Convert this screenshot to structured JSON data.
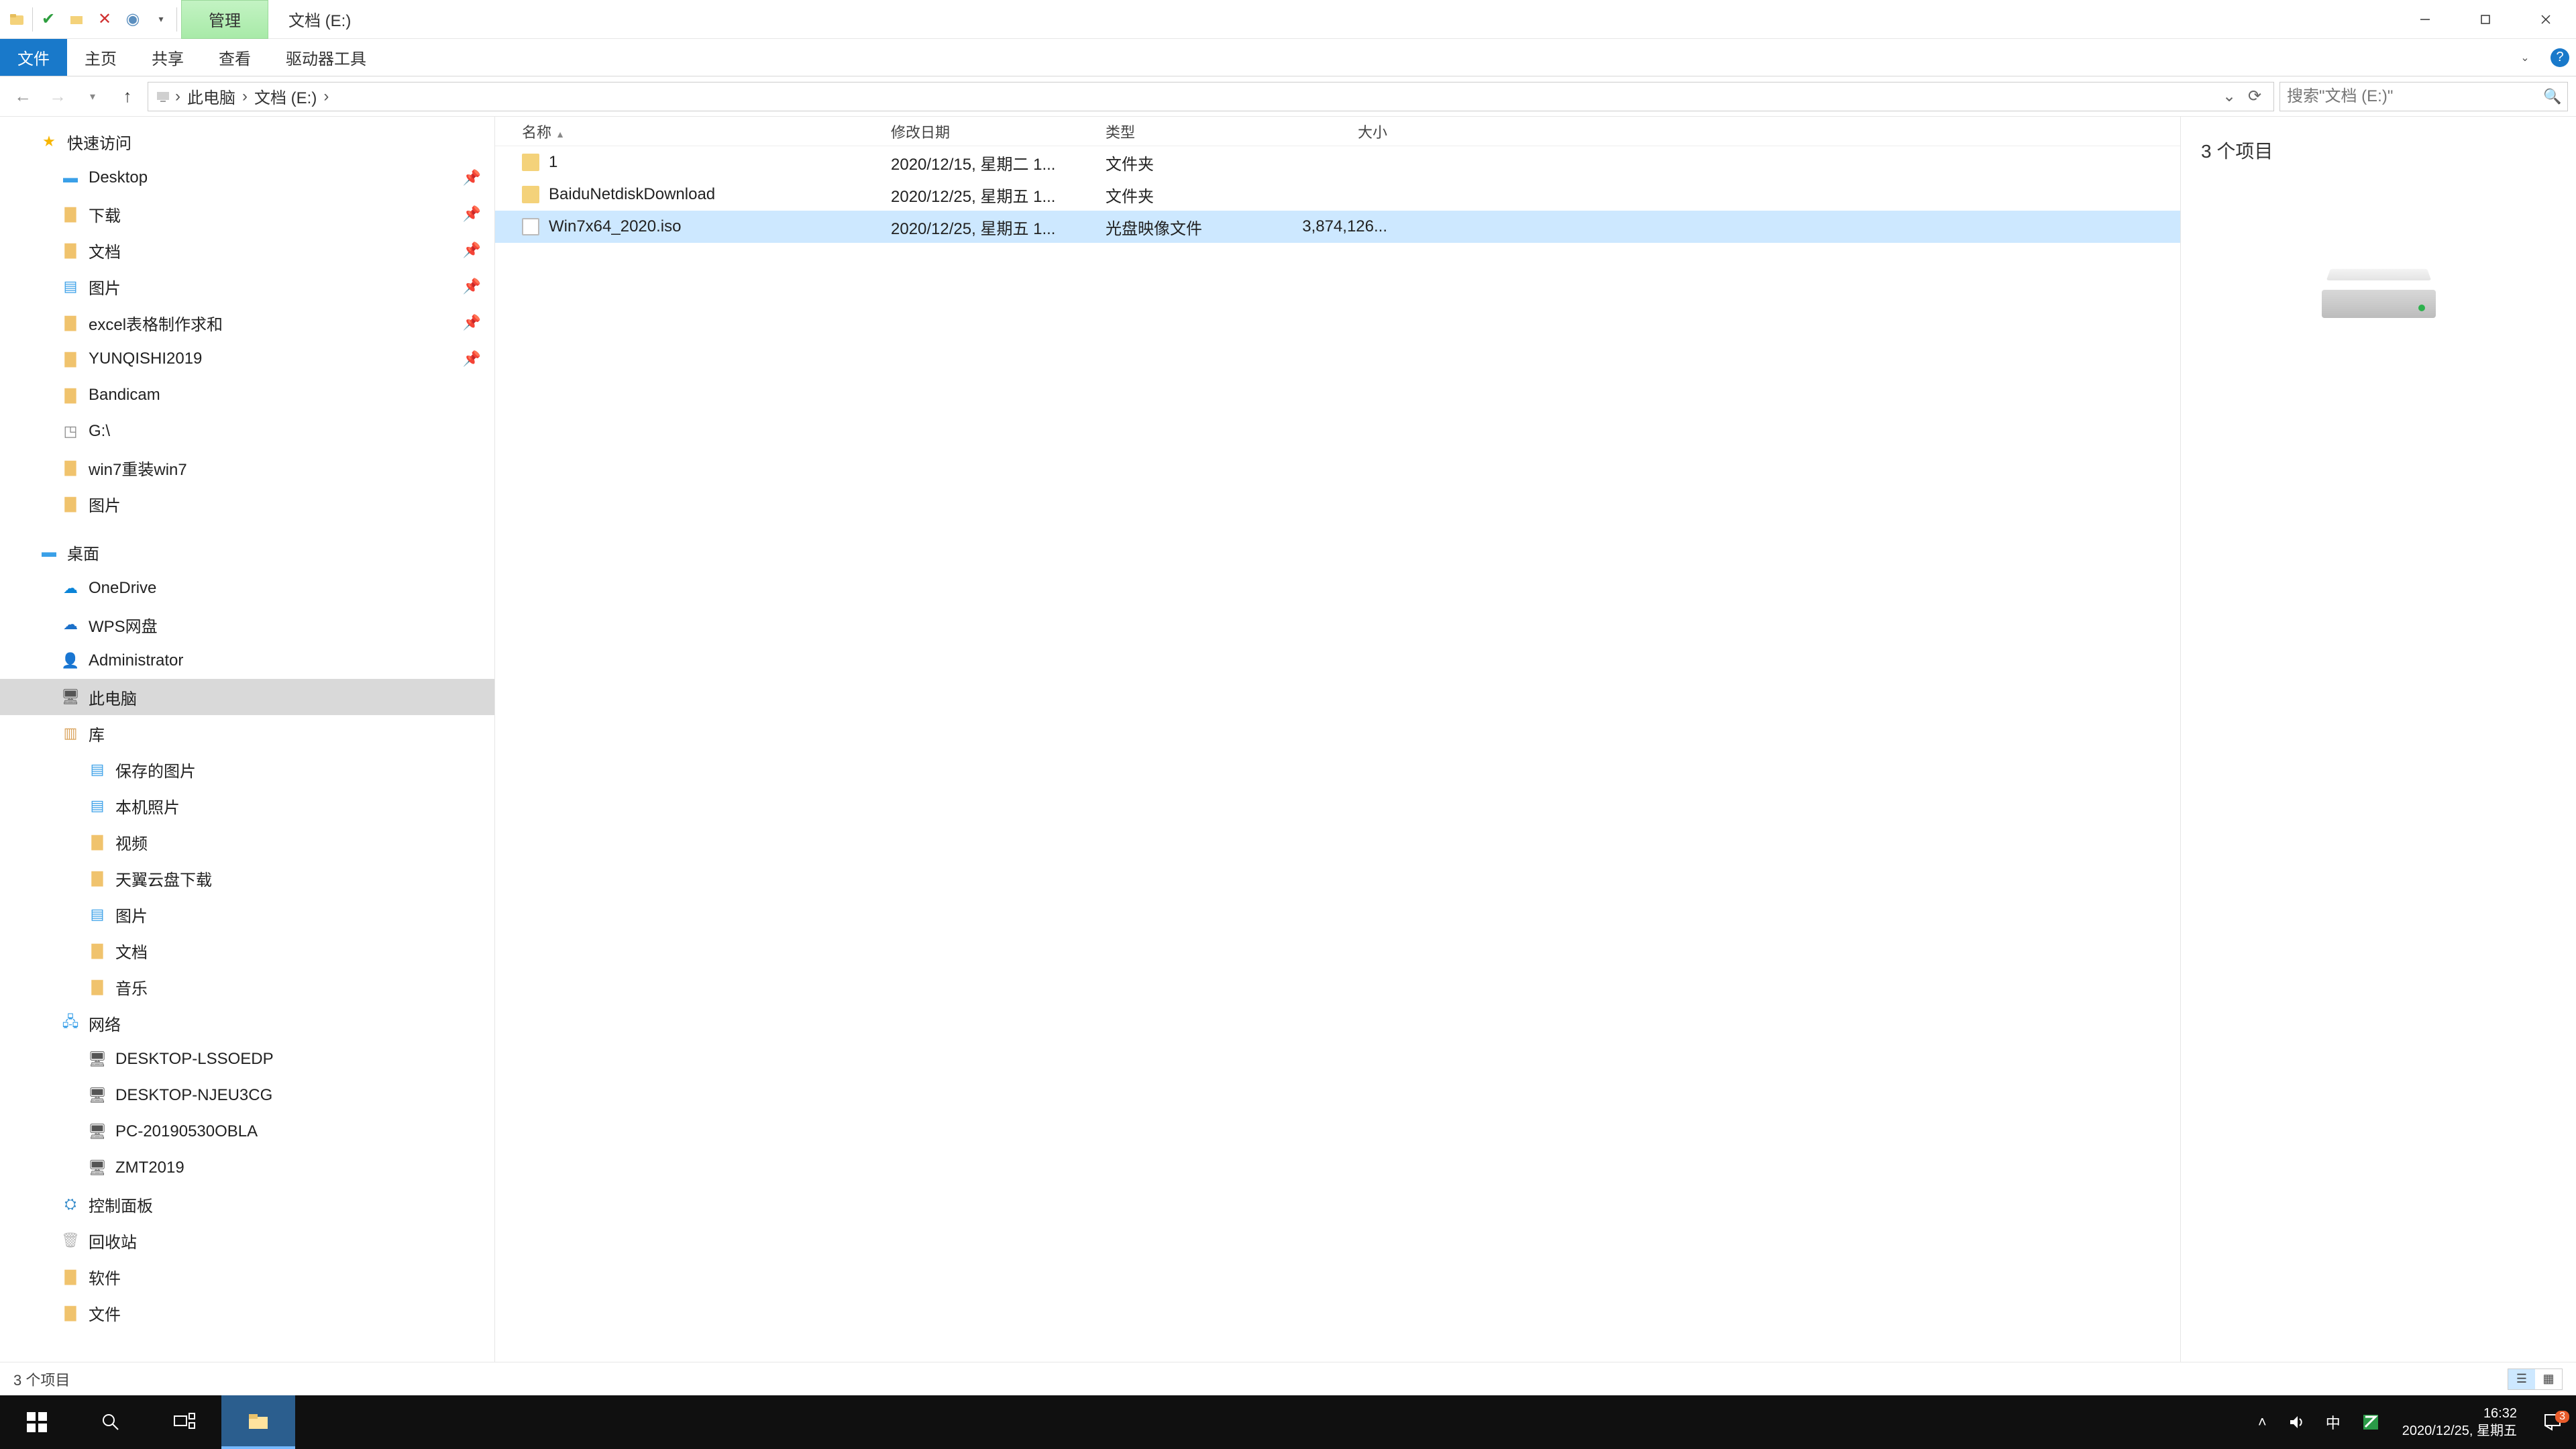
{
  "title": {
    "context_tab": "管理",
    "window_title": "文档 (E:)"
  },
  "ribbon": {
    "file": "文件",
    "tabs": [
      "主页",
      "共享",
      "查看",
      "驱动器工具"
    ]
  },
  "breadcrumb": [
    "此电脑",
    "文档 (E:)"
  ],
  "search": {
    "placeholder": "搜索\"文档 (E:)\""
  },
  "columns": {
    "name": "名称",
    "date": "修改日期",
    "type": "类型",
    "size": "大小"
  },
  "rows": [
    {
      "name": "1",
      "date": "2020/12/15, 星期二 1...",
      "type": "文件夹",
      "size": "",
      "kind": "folder",
      "selected": false
    },
    {
      "name": "BaiduNetdiskDownload",
      "date": "2020/12/25, 星期五 1...",
      "type": "文件夹",
      "size": "",
      "kind": "folder",
      "selected": false
    },
    {
      "name": "Win7x64_2020.iso",
      "date": "2020/12/25, 星期五 1...",
      "type": "光盘映像文件",
      "size": "3,874,126...",
      "kind": "iso",
      "selected": true
    }
  ],
  "nav": {
    "quick": {
      "label": "快速访问",
      "items": [
        {
          "label": "Desktop",
          "icon": "desktop",
          "pin": true
        },
        {
          "label": "下载",
          "icon": "folder",
          "pin": true
        },
        {
          "label": "文档",
          "icon": "folder",
          "pin": true
        },
        {
          "label": "图片",
          "icon": "pic",
          "pin": true
        },
        {
          "label": "excel表格制作求和",
          "icon": "folder",
          "pin": true
        },
        {
          "label": "YUNQISHI2019",
          "icon": "folder",
          "pin": true
        },
        {
          "label": "Bandicam",
          "icon": "folder",
          "pin": false
        },
        {
          "label": "G:\\",
          "icon": "drive",
          "pin": false
        },
        {
          "label": "win7重装win7",
          "icon": "folder",
          "pin": false
        },
        {
          "label": "图片",
          "icon": "folder",
          "pin": false
        }
      ]
    },
    "desktop": {
      "label": "桌面",
      "items": [
        {
          "label": "OneDrive",
          "icon": "onedrive"
        },
        {
          "label": "WPS网盘",
          "icon": "wps"
        },
        {
          "label": "Administrator",
          "icon": "user"
        },
        {
          "label": "此电脑",
          "icon": "pc",
          "selected": true
        },
        {
          "label": "库",
          "icon": "lib"
        },
        {
          "label": "保存的图片",
          "icon": "pic",
          "indent": true
        },
        {
          "label": "本机照片",
          "icon": "pic",
          "indent": true
        },
        {
          "label": "视频",
          "icon": "folder",
          "indent": true
        },
        {
          "label": "天翼云盘下载",
          "icon": "folder",
          "indent": true
        },
        {
          "label": "图片",
          "icon": "pic",
          "indent": true
        },
        {
          "label": "文档",
          "icon": "folder",
          "indent": true
        },
        {
          "label": "音乐",
          "icon": "folder",
          "indent": true
        },
        {
          "label": "网络",
          "icon": "net"
        },
        {
          "label": "DESKTOP-LSSOEDP",
          "icon": "pc",
          "indent": true
        },
        {
          "label": "DESKTOP-NJEU3CG",
          "icon": "pc",
          "indent": true
        },
        {
          "label": "PC-20190530OBLA",
          "icon": "pc",
          "indent": true
        },
        {
          "label": "ZMT2019",
          "icon": "pc",
          "indent": true
        },
        {
          "label": "控制面板",
          "icon": "cp"
        },
        {
          "label": "回收站",
          "icon": "bin"
        },
        {
          "label": "软件",
          "icon": "folder"
        },
        {
          "label": "文件",
          "icon": "folder"
        }
      ]
    }
  },
  "preview": {
    "count_text": "3 个项目"
  },
  "status": {
    "text": "3 个项目"
  },
  "tray": {
    "ime": "中",
    "time": "16:32",
    "date": "2020/12/25, 星期五",
    "notif_badge": "3"
  }
}
